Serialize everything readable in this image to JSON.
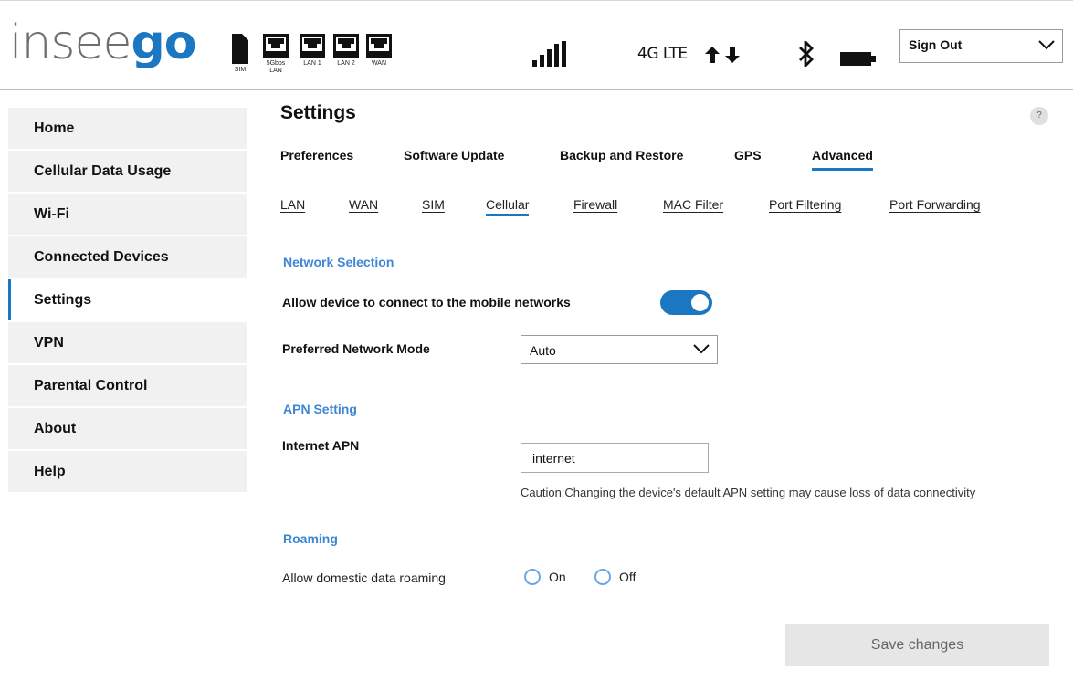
{
  "brand": {
    "logo_a": "insee",
    "logo_b": "go"
  },
  "status": {
    "ports": [
      {
        "label": "SIM"
      },
      {
        "label": "5Gbps LAN"
      },
      {
        "label": "LAN 1"
      },
      {
        "label": "LAN 2"
      },
      {
        "label": "WAN"
      }
    ],
    "network_type": "4G LTE",
    "sign_out": "Sign Out"
  },
  "sidebar": {
    "items": [
      {
        "label": "Home"
      },
      {
        "label": "Cellular Data Usage"
      },
      {
        "label": "Wi-Fi"
      },
      {
        "label": "Connected Devices"
      },
      {
        "label": "Settings"
      },
      {
        "label": "VPN"
      },
      {
        "label": "Parental Control"
      },
      {
        "label": "About"
      },
      {
        "label": "Help"
      }
    ]
  },
  "main": {
    "title": "Settings",
    "help": "?",
    "tabs": [
      {
        "label": "Preferences"
      },
      {
        "label": "Software Update"
      },
      {
        "label": "Backup and Restore"
      },
      {
        "label": "GPS"
      },
      {
        "label": "Advanced"
      }
    ],
    "subtabs": [
      {
        "label": "LAN"
      },
      {
        "label": "WAN"
      },
      {
        "label": "SIM"
      },
      {
        "label": "Cellular"
      },
      {
        "label": "Firewall"
      },
      {
        "label": "MAC Filter"
      },
      {
        "label": "Port Filtering"
      },
      {
        "label": "Port Forwarding"
      }
    ]
  },
  "form": {
    "network_section": "Network Selection",
    "allow_connect_label": "Allow device to connect to the mobile networks",
    "allow_connect_on": true,
    "preferred_mode_label": "Preferred Network Mode",
    "preferred_mode_value": "Auto",
    "apn_section": "APN Setting",
    "internet_apn_label": "Internet APN",
    "internet_apn_value": "internet",
    "caution": "Caution:Changing the device's default APN setting may cause loss of data connectivity",
    "roaming_section": "Roaming",
    "roaming_label": "Allow domestic data roaming",
    "roaming_on": "On",
    "roaming_off": "Off",
    "save": "Save changes"
  },
  "colors": {
    "accent": "#1c77c3",
    "section": "#3d86d6",
    "sidebar_bg": "#f1f1f1"
  }
}
